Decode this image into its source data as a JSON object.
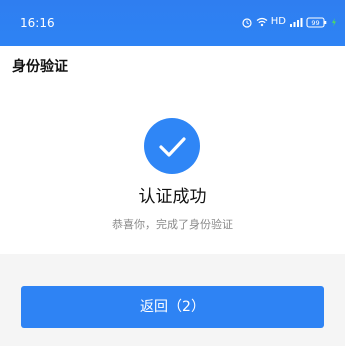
{
  "status_bar": {
    "time": "16:16",
    "network_label": "HD",
    "signal_label": "4G",
    "battery_label": "99"
  },
  "header": {
    "title": "身份验证"
  },
  "result": {
    "icon": "check-icon",
    "title": "认证成功",
    "description": "恭喜你，完成了身份验证"
  },
  "actions": {
    "return_label": "返回（2）"
  },
  "colors": {
    "accent": "#2e83f4",
    "background": "#f5f5f5",
    "title_text": "#111111",
    "muted_text": "#8a8a8a"
  }
}
